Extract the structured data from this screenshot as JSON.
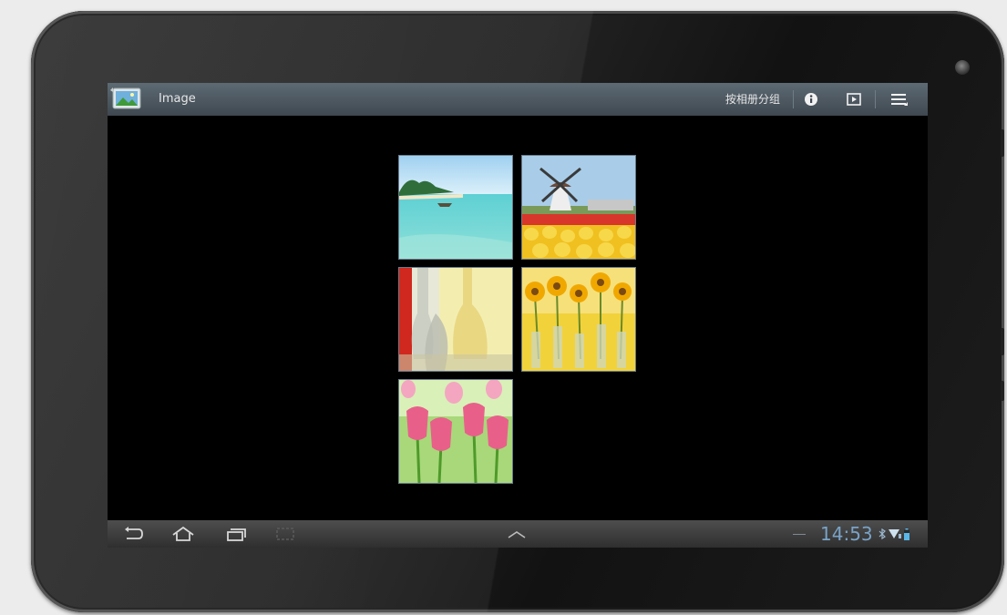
{
  "action_bar": {
    "app_icon": "gallery-icon",
    "title": "Image",
    "group_by_album": "按相册分组",
    "info_icon": "info-icon",
    "slideshow_icon": "slideshow-icon",
    "menu_icon": "overflow-menu-icon"
  },
  "grid": {
    "thumbnails": [
      {
        "subject": "tropical-beach"
      },
      {
        "subject": "windmill-tulips"
      },
      {
        "subject": "glass-vases"
      },
      {
        "subject": "sunflowers"
      },
      {
        "subject": "pink-tulips"
      }
    ]
  },
  "nav_bar": {
    "back_icon": "back-icon",
    "home_icon": "home-icon",
    "recents_icon": "recent-apps-icon",
    "screenshot_icon": "screenshot-icon",
    "up_icon": "chevron-up-icon",
    "time": "14:53",
    "status_icons": [
      "bluetooth-icon",
      "wifi-icon",
      "battery-icon"
    ]
  },
  "colors": {
    "clock": "#7aa3c8",
    "action_bar": "#4f5b64",
    "screen": "#000000"
  }
}
